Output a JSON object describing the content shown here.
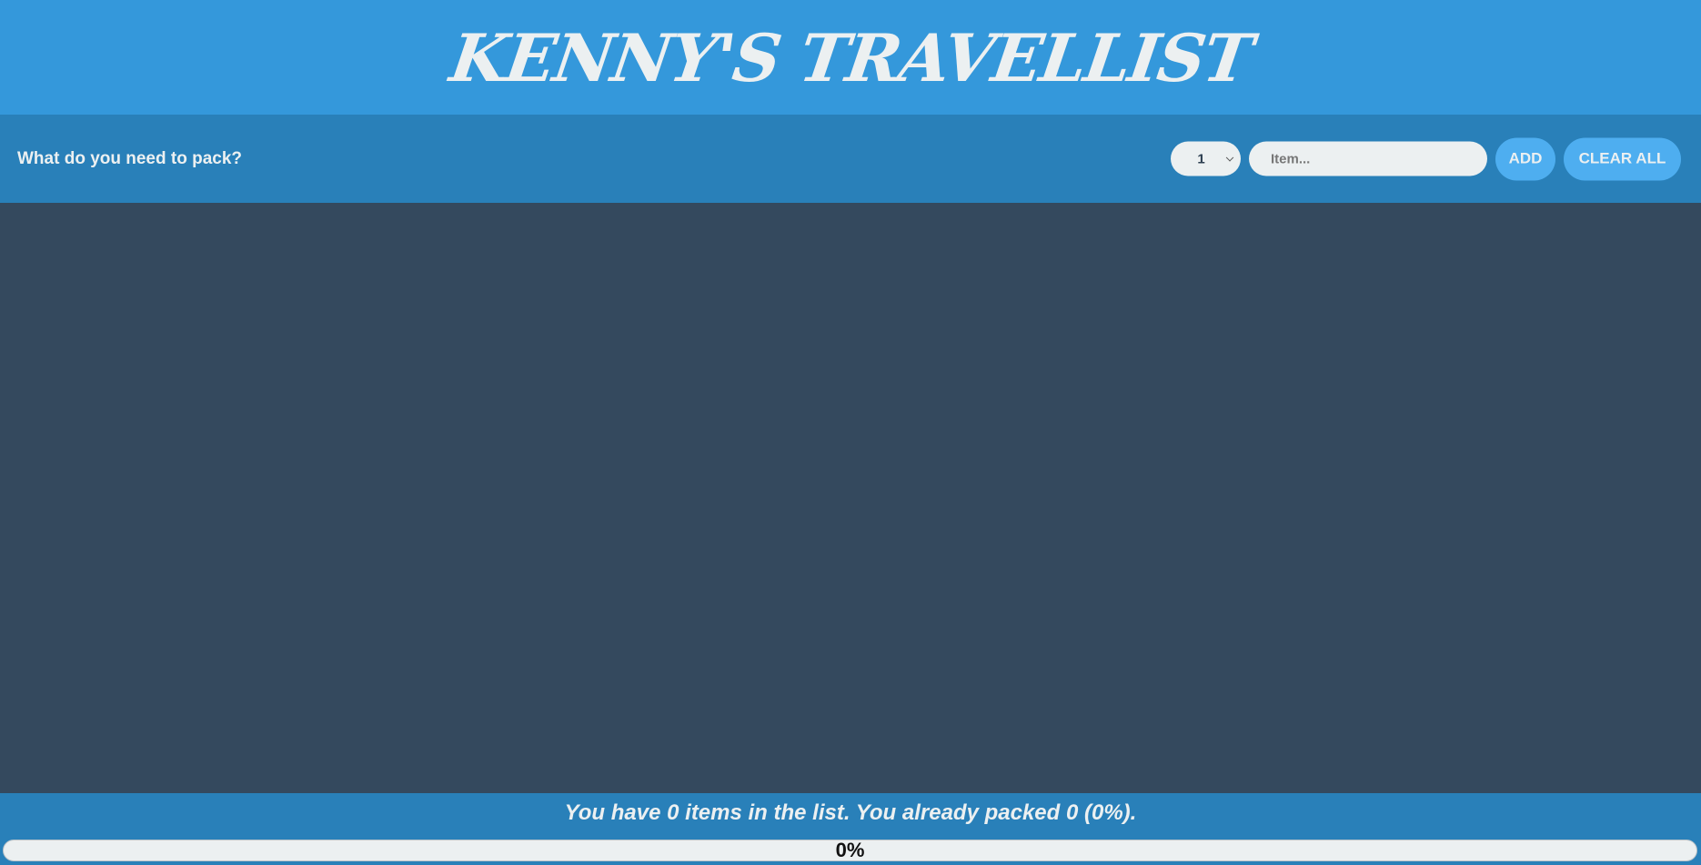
{
  "header": {
    "title": "Kenny's TravelList"
  },
  "form": {
    "prompt": "What do you need to pack?",
    "quantity_selected": "1",
    "item_placeholder": "Item...",
    "item_value": "",
    "add_label": "ADD",
    "clear_label": "CLEAR ALL"
  },
  "list": {
    "items": []
  },
  "stats": {
    "text": "You have 0 items in the list. You already packed 0 (0%).",
    "progress_percent": 0,
    "progress_label": "0%"
  },
  "colors": {
    "header_bg": "#3498db",
    "bar_bg": "#2980b9",
    "list_bg": "#34495e",
    "button_bg": "#4eaef0",
    "text_light": "#ecf0f1"
  }
}
